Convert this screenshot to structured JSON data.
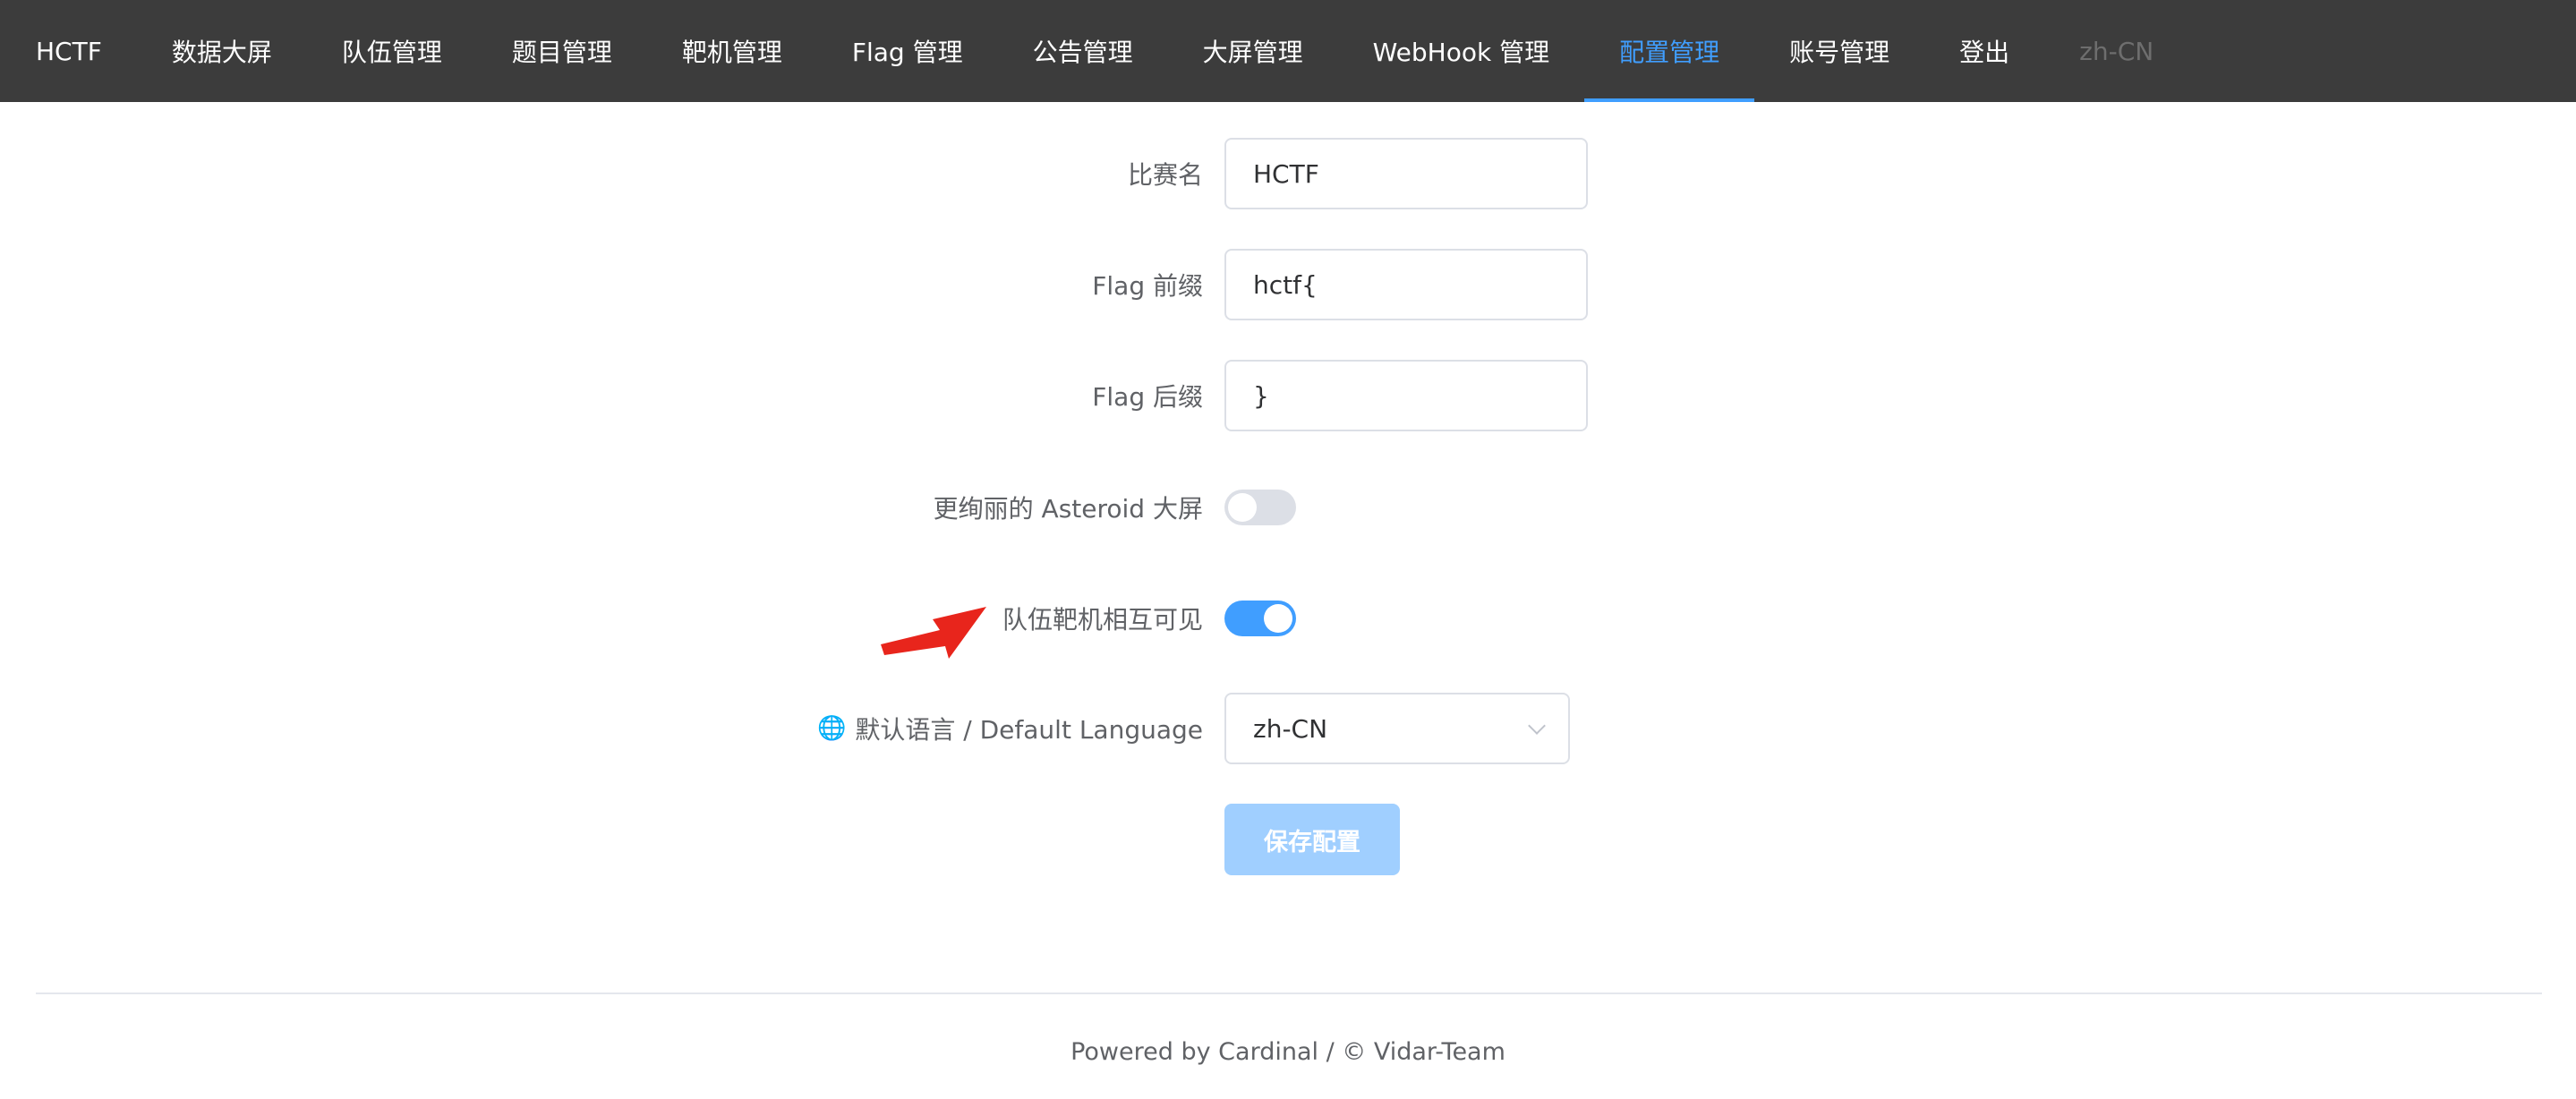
{
  "nav": {
    "items": [
      {
        "label": "HCTF"
      },
      {
        "label": "数据大屏"
      },
      {
        "label": "队伍管理"
      },
      {
        "label": "题目管理"
      },
      {
        "label": "靶机管理"
      },
      {
        "label": "Flag 管理"
      },
      {
        "label": "公告管理"
      },
      {
        "label": "大屏管理"
      },
      {
        "label": "WebHook 管理"
      },
      {
        "label": "配置管理",
        "active": true
      },
      {
        "label": "账号管理"
      },
      {
        "label": "登出"
      }
    ],
    "language": "zh-CN"
  },
  "form": {
    "competition_name": {
      "label": "比赛名",
      "value": "HCTF"
    },
    "flag_prefix": {
      "label": "Flag 前缀",
      "value": "hctf{"
    },
    "flag_suffix": {
      "label": "Flag 后缀",
      "value": "}"
    },
    "asteroid_screen": {
      "label": "更绚丽的 Asteroid 大屏",
      "enabled": false
    },
    "team_machines_visible": {
      "label": "队伍靶机相互可见",
      "enabled": true
    },
    "default_language": {
      "label": "默认语言 / Default Language",
      "value": "zh-CN",
      "icon": "globe-icon"
    },
    "save_label": "保存配置"
  },
  "annotation": {
    "arrow_color": "#e8251c"
  },
  "colors": {
    "accent": "#409eff",
    "nav_bg": "#3c3c3c",
    "save_button": "#a0cfff"
  },
  "footer": {
    "text": "Powered by Cardinal / © Vidar-Team"
  }
}
